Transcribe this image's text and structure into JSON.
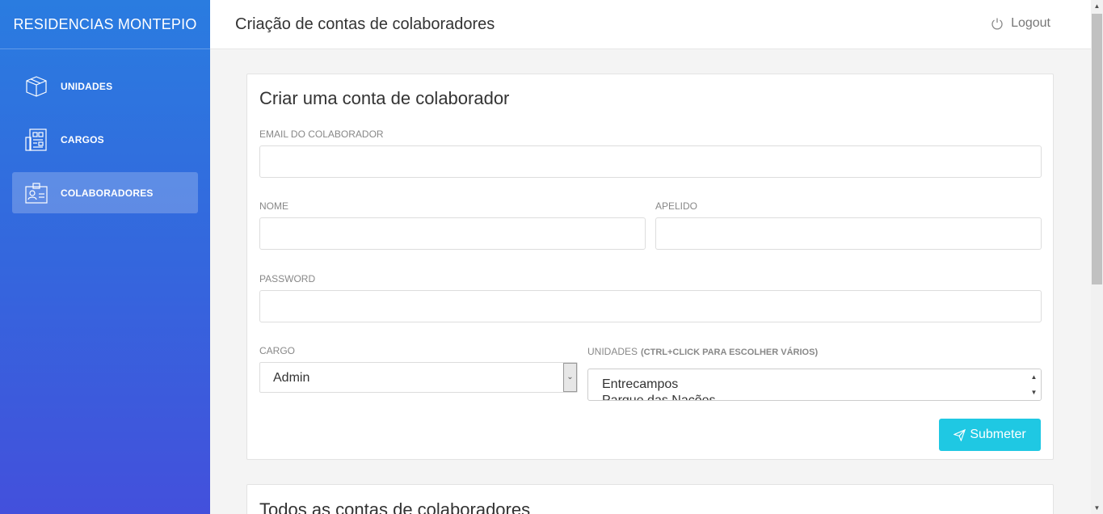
{
  "brand": "RESIDENCIAS MONTEPIO",
  "sidebar": {
    "items": [
      {
        "label": "UNIDADES",
        "icon": "cube-icon"
      },
      {
        "label": "CARGOS",
        "icon": "building-icon"
      },
      {
        "label": "COLABORADORES",
        "icon": "id-card-icon"
      }
    ]
  },
  "header": {
    "title": "Criação de contas de colaboradores",
    "logout_label": "Logout"
  },
  "form": {
    "title": "Criar uma conta de colaborador",
    "email_label": "EMAIL DO COLABORADOR",
    "email_value": "",
    "nome_label": "NOME",
    "nome_value": "",
    "apelido_label": "APELIDO",
    "apelido_value": "",
    "password_label": "PASSWORD",
    "password_value": "",
    "cargo_label": "CARGO",
    "cargo_selected": "Admin",
    "unidades_label": "UNIDADES",
    "unidades_hint": "(CTRL+CLICK PARA ESCOLHER VÁRIOS)",
    "unidades_options": [
      "Entrecampos",
      "Parque das Nações"
    ],
    "submit_label": "Submeter"
  },
  "list": {
    "title": "Todos as contas de colaboradores"
  },
  "colors": {
    "sidebar_top": "#2a7ce0",
    "sidebar_bottom": "#4350dc",
    "submit": "#1fc8e3"
  }
}
